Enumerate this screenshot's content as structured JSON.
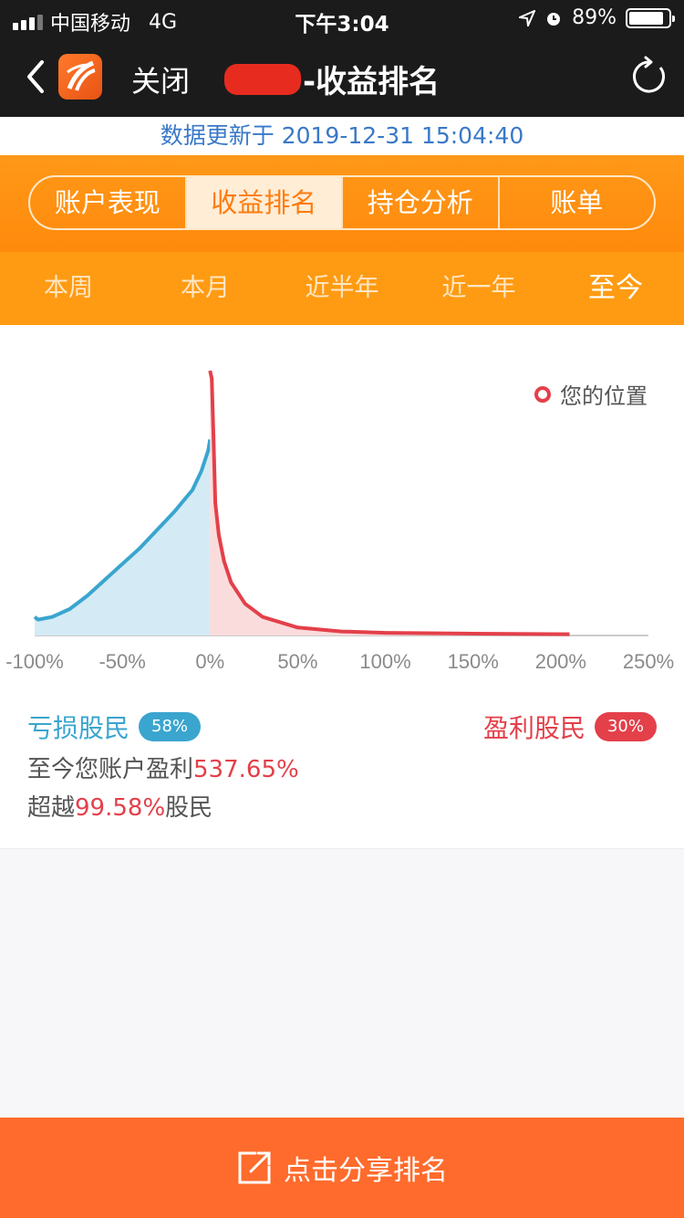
{
  "status_bar": {
    "carrier": "中国移动",
    "network": "4G",
    "time": "下午3:04",
    "battery": "89%",
    "battery_level": 0.89
  },
  "nav": {
    "close_label": "关闭",
    "title_suffix": "-收益排名"
  },
  "update_text": "数据更新于 2019-12-31 15:04:40",
  "tabs": [
    {
      "label": "账户表现",
      "active": false
    },
    {
      "label": "收益排名",
      "active": true
    },
    {
      "label": "持仓分析",
      "active": false
    },
    {
      "label": "账单",
      "active": false
    }
  ],
  "periods": [
    {
      "label": "本周",
      "active": false
    },
    {
      "label": "本月",
      "active": false
    },
    {
      "label": "近半年",
      "active": false
    },
    {
      "label": "近一年",
      "active": false
    },
    {
      "label": "至今",
      "active": true
    }
  ],
  "chart_data": {
    "type": "area",
    "legend": "您的位置",
    "legend_position": "top-right",
    "x_ticks": [
      "-100%",
      "-50%",
      "0%",
      "50%",
      "100%",
      "150%",
      "200%",
      "250%"
    ],
    "x_range": [
      -100,
      250
    ],
    "x_unit": "%",
    "series": [
      {
        "color": "#3aa5cf",
        "fill": "#d4ebf5",
        "x": [
          -100,
          -98,
          -90,
          -80,
          -70,
          -60,
          -50,
          -40,
          -30,
          -20,
          -10,
          -5,
          -1,
          0
        ],
        "y": [
          7,
          6,
          7,
          10,
          15,
          21,
          27,
          33,
          40,
          47,
          55,
          62,
          70,
          74
        ]
      },
      {
        "color": "#e3404a",
        "fill": "#fbdcdc",
        "x": [
          0,
          1,
          2,
          3,
          5,
          8,
          12,
          20,
          30,
          50,
          75,
          100,
          150,
          205
        ],
        "y": [
          100,
          97,
          75,
          50,
          38,
          28,
          20,
          12,
          7,
          3,
          1.5,
          1,
          0.7,
          0.5
        ]
      }
    ],
    "you_are_here": 537.65
  },
  "loss": {
    "label": "亏损股民",
    "pct": "58%"
  },
  "gain": {
    "label": "盈利股民",
    "pct": "30%"
  },
  "summary": {
    "line1_prefix": "至今您账户盈利",
    "line1_value": "537.65%",
    "line2_prefix": "超越",
    "line2_value": "99.58%",
    "line2_suffix": "股民"
  },
  "share": {
    "label": "点击分享排名"
  },
  "colors": {
    "accent": "#ff8a0c",
    "share": "#ff6b2c",
    "loss": "#3aa5cf",
    "gain": "#e3404a"
  }
}
